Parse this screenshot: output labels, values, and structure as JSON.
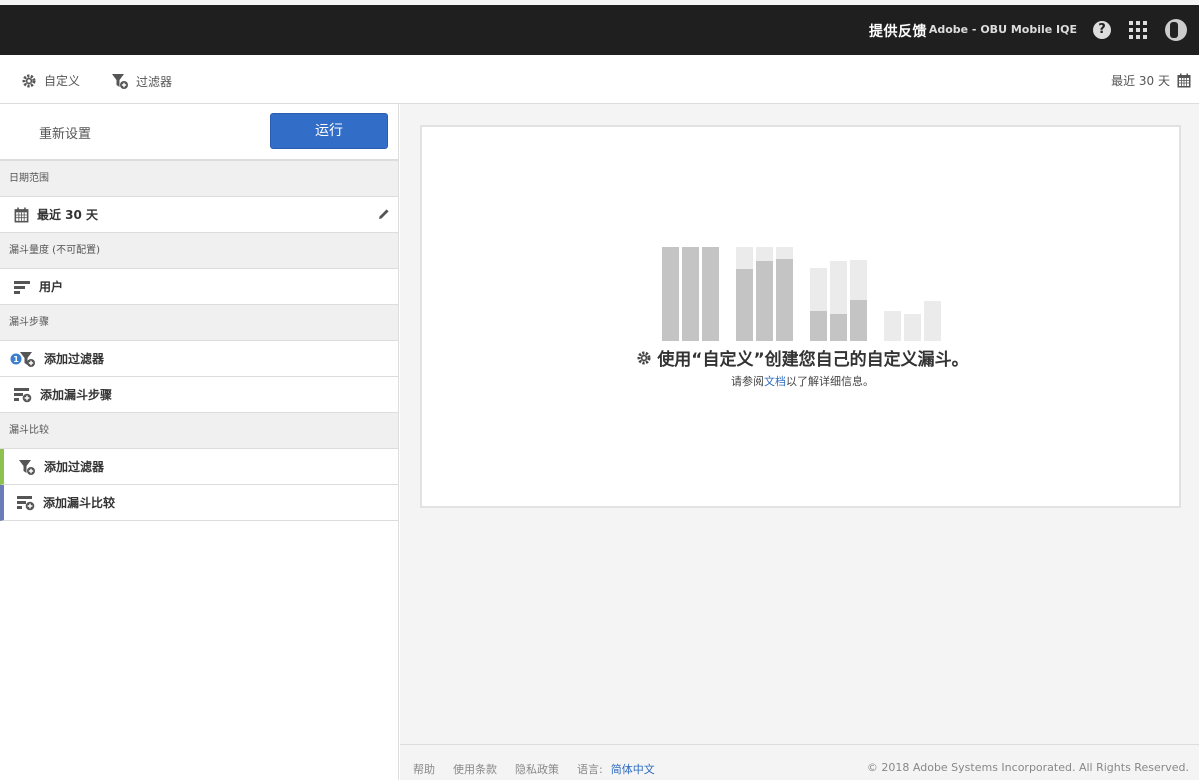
{
  "topbar": {
    "feedback": "提供反馈",
    "org": "Adobe - OBU Mobile IQE",
    "help": "?"
  },
  "toolbar": {
    "customize": "自定义",
    "filter": "过滤器",
    "date_range": "最近 30 天"
  },
  "sidebar": {
    "reset": "重新设置",
    "run": "运行",
    "sections": {
      "date_range": {
        "title": "日期范围",
        "value": "最近 30 天"
      },
      "metric": {
        "title": "漏斗量度 (不可配置)",
        "value": "用户"
      },
      "steps": {
        "title": "漏斗步骤",
        "add_filter": "添加过滤器",
        "add_step": "添加漏斗步骤"
      },
      "compare": {
        "title": "漏斗比较",
        "add_filter": "添加过滤器",
        "add_compare": "添加漏斗比较"
      }
    },
    "badge": "1"
  },
  "empty_state": {
    "title": "使用“自定义”创建您自己的自定义漏斗。",
    "sub_before": "请参阅",
    "sub_link": "文档",
    "sub_after": "以了解详细信息。"
  },
  "footer": {
    "help": "帮助",
    "terms": "使用条款",
    "privacy": "隐私政策",
    "lang_label": "语言:",
    "lang_value": "简体中文",
    "copyright": "© 2018 Adobe Systems Incorporated. All Rights Reserved."
  },
  "colors": {
    "topbar": "#1f1f1f",
    "run_button": "#326ec8",
    "link": "#2d6bc0",
    "accent_green": "#8dc150",
    "accent_blue": "#6b7cb8"
  }
}
